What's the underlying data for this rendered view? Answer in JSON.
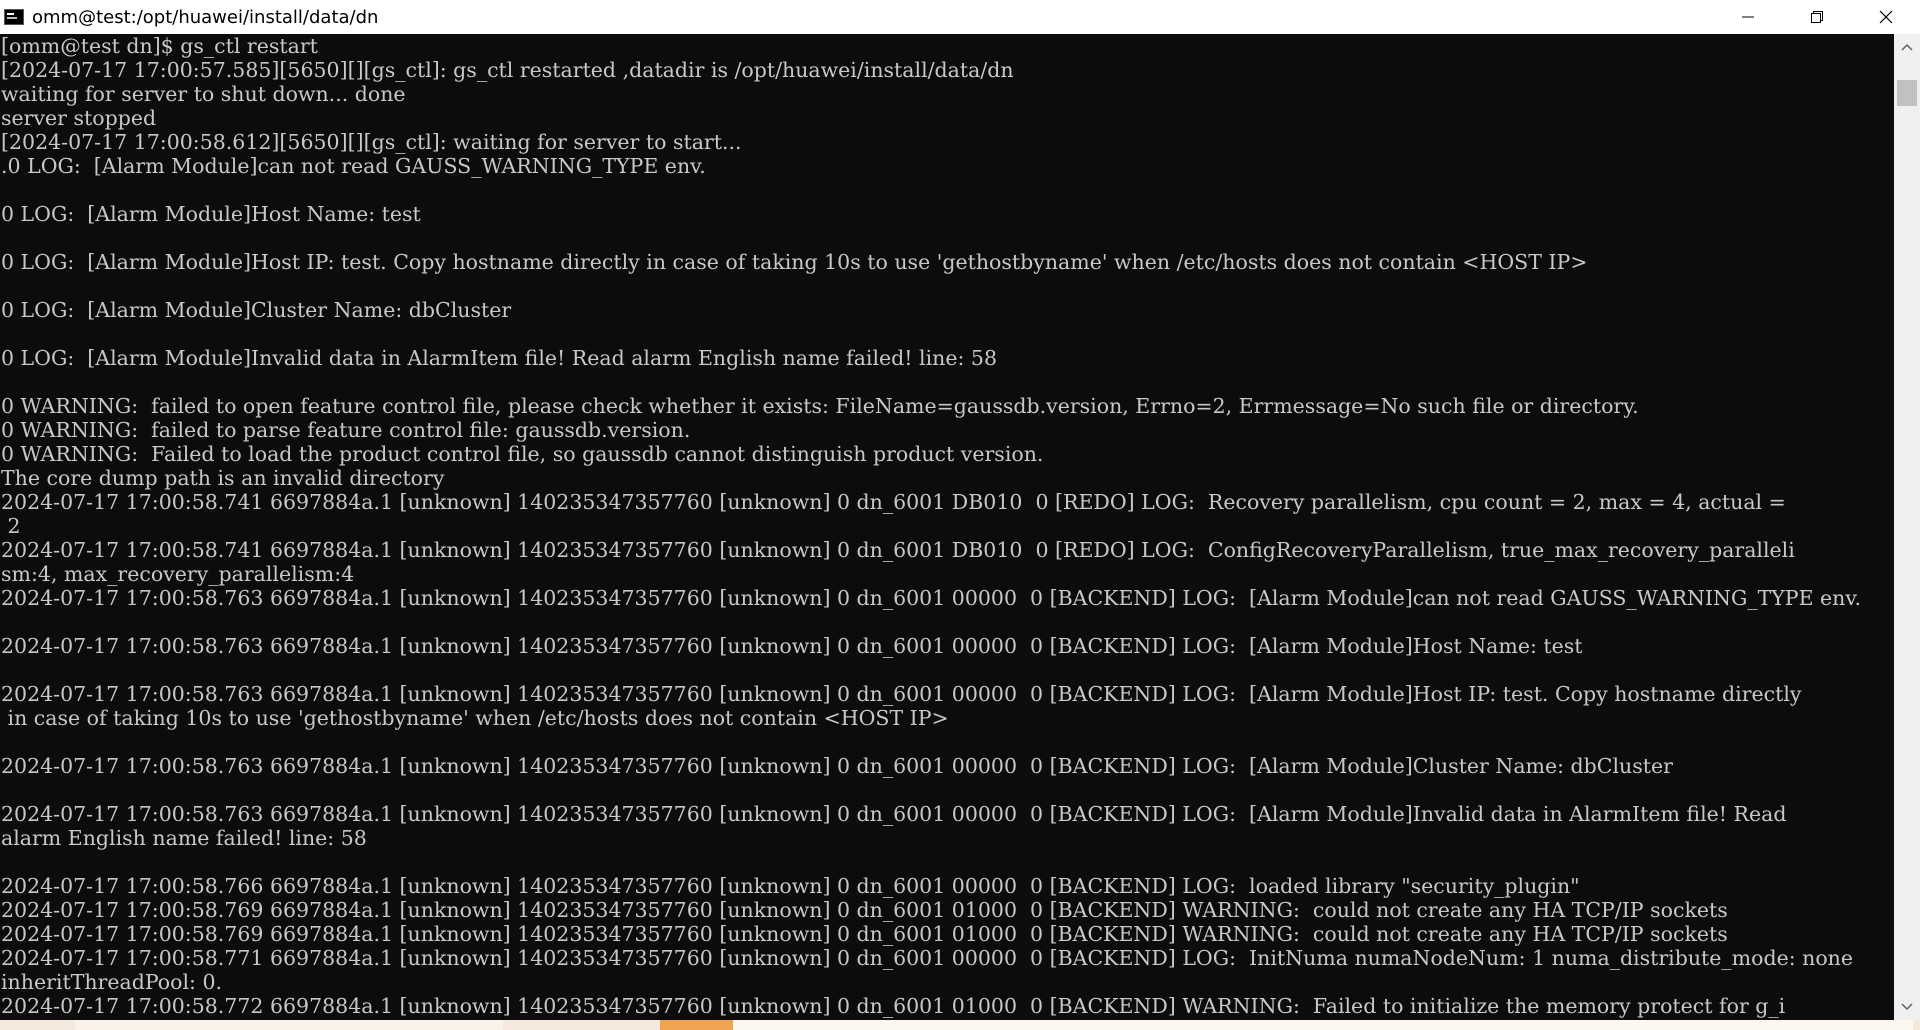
{
  "window": {
    "title": "omm@test:/opt/huawei/install/data/dn"
  },
  "terminal": {
    "lines": [
      "[omm@test dn]$ gs_ctl restart",
      "[2024-07-17 17:00:57.585][5650][][gs_ctl]: gs_ctl restarted ,datadir is /opt/huawei/install/data/dn",
      "waiting for server to shut down... done",
      "server stopped",
      "[2024-07-17 17:00:58.612][5650][][gs_ctl]: waiting for server to start...",
      ".0 LOG:  [Alarm Module]can not read GAUSS_WARNING_TYPE env.",
      "",
      "0 LOG:  [Alarm Module]Host Name: test",
      "",
      "0 LOG:  [Alarm Module]Host IP: test. Copy hostname directly in case of taking 10s to use 'gethostbyname' when /etc/hosts does not contain <HOST IP>",
      "",
      "0 LOG:  [Alarm Module]Cluster Name: dbCluster",
      "",
      "0 LOG:  [Alarm Module]Invalid data in AlarmItem file! Read alarm English name failed! line: 58",
      "",
      "0 WARNING:  failed to open feature control file, please check whether it exists: FileName=gaussdb.version, Errno=2, Errmessage=No such file or directory.",
      "0 WARNING:  failed to parse feature control file: gaussdb.version.",
      "0 WARNING:  Failed to load the product control file, so gaussdb cannot distinguish product version.",
      "The core dump path is an invalid directory",
      "2024-07-17 17:00:58.741 6697884a.1 [unknown] 140235347357760 [unknown] 0 dn_6001 DB010  0 [REDO] LOG:  Recovery parallelism, cpu count = 2, max = 4, actual =",
      " 2",
      "2024-07-17 17:00:58.741 6697884a.1 [unknown] 140235347357760 [unknown] 0 dn_6001 DB010  0 [REDO] LOG:  ConfigRecoveryParallelism, true_max_recovery_paralleli",
      "sm:4, max_recovery_parallelism:4",
      "2024-07-17 17:00:58.763 6697884a.1 [unknown] 140235347357760 [unknown] 0 dn_6001 00000  0 [BACKEND] LOG:  [Alarm Module]can not read GAUSS_WARNING_TYPE env.",
      "",
      "2024-07-17 17:00:58.763 6697884a.1 [unknown] 140235347357760 [unknown] 0 dn_6001 00000  0 [BACKEND] LOG:  [Alarm Module]Host Name: test",
      "",
      "2024-07-17 17:00:58.763 6697884a.1 [unknown] 140235347357760 [unknown] 0 dn_6001 00000  0 [BACKEND] LOG:  [Alarm Module]Host IP: test. Copy hostname directly",
      " in case of taking 10s to use 'gethostbyname' when /etc/hosts does not contain <HOST IP>",
      "",
      "2024-07-17 17:00:58.763 6697884a.1 [unknown] 140235347357760 [unknown] 0 dn_6001 00000  0 [BACKEND] LOG:  [Alarm Module]Cluster Name: dbCluster",
      "",
      "2024-07-17 17:00:58.763 6697884a.1 [unknown] 140235347357760 [unknown] 0 dn_6001 00000  0 [BACKEND] LOG:  [Alarm Module]Invalid data in AlarmItem file! Read",
      "alarm English name failed! line: 58",
      "",
      "2024-07-17 17:00:58.766 6697884a.1 [unknown] 140235347357760 [unknown] 0 dn_6001 00000  0 [BACKEND] LOG:  loaded library \"security_plugin\"",
      "2024-07-17 17:00:58.769 6697884a.1 [unknown] 140235347357760 [unknown] 0 dn_6001 01000  0 [BACKEND] WARNING:  could not create any HA TCP/IP sockets",
      "2024-07-17 17:00:58.769 6697884a.1 [unknown] 140235347357760 [unknown] 0 dn_6001 01000  0 [BACKEND] WARNING:  could not create any HA TCP/IP sockets",
      "2024-07-17 17:00:58.771 6697884a.1 [unknown] 140235347357760 [unknown] 0 dn_6001 00000  0 [BACKEND] LOG:  InitNuma numaNodeNum: 1 numa_distribute_mode: none",
      "inheritThreadPool: 0.",
      "2024-07-17 17:00:58.772 6697884a.1 [unknown] 140235347357760 [unknown] 0 dn_6001 01000  0 [BACKEND] WARNING:  Failed to initialize the memory protect for g_i"
    ]
  },
  "icons": {
    "app": "console-icon",
    "minimize": "minimize-icon",
    "restore": "restore-icon",
    "close": "close-icon",
    "scroll_up": "scroll-up-arrow-icon",
    "scroll_down": "scroll-down-arrow-icon"
  },
  "colors": {
    "terminal_bg": "#0c0c0c",
    "terminal_fg": "#c8c8c8",
    "titlebar_bg": "#ffffff"
  }
}
